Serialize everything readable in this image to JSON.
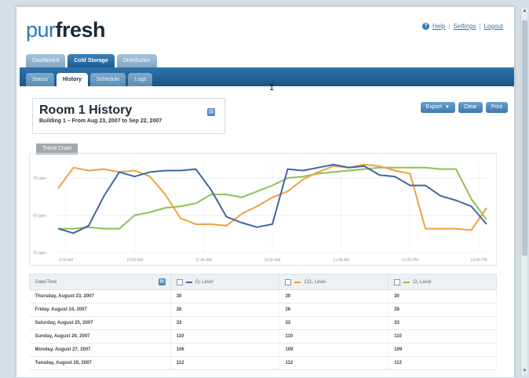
{
  "logo": {
    "light": "pur",
    "bold": "fresh"
  },
  "top_links": {
    "help": "Help",
    "settings": "Settings",
    "logout": "Logout"
  },
  "main_tabs": [
    {
      "label": "Dashboard",
      "active": false
    },
    {
      "label": "Cold Storage",
      "active": true
    },
    {
      "label": "Distribution",
      "active": false
    }
  ],
  "sub_tabs": [
    {
      "label": "Status",
      "active": false
    },
    {
      "label": "History",
      "active": true
    },
    {
      "label": "Schedule",
      "active": false
    },
    {
      "label": "Logs",
      "active": false
    }
  ],
  "header": {
    "title": "Room 1 History",
    "subtitle": "Building 1 – From Aug 23, 2007 to Sep 22, 2007"
  },
  "actions": {
    "export": "Export",
    "clear": "Clear",
    "print": "Print"
  },
  "trend_button": "Trend Chart",
  "colors": {
    "series1": "#3f67a1",
    "series2": "#f0a040",
    "series3": "#8fc04f",
    "accent": "#2d78b7"
  },
  "chart_data": {
    "type": "line",
    "x": [
      "9:00 AM",
      "10:00 AM",
      "11:00 AM",
      "11:00 AM",
      "11:00 AM",
      "12:00 PM",
      "12:00 PM"
    ],
    "yticks": [
      "25 ppm",
      "50 ppm",
      "75 ppm"
    ],
    "ylim": [
      25,
      85
    ],
    "grid": true,
    "series": [
      {
        "color": "#3f67a1",
        "values": [
          41,
          38,
          43,
          63,
          79,
          76,
          79,
          80,
          80,
          81,
          67,
          49,
          45,
          42,
          44,
          81,
          80,
          82,
          84,
          82,
          83,
          77,
          76,
          70,
          70,
          63,
          60,
          56,
          44
        ]
      },
      {
        "color": "#f0a040",
        "values": [
          68,
          82,
          80,
          81,
          79,
          80,
          76,
          64,
          48,
          44,
          44,
          43,
          51,
          56,
          62,
          66,
          74,
          79,
          83,
          82,
          84,
          83,
          80,
          78,
          41,
          41,
          41,
          40,
          55
        ]
      },
      {
        "color": "#8fc04f",
        "values": [
          41,
          41,
          42,
          41,
          41,
          50,
          52,
          55,
          56,
          58,
          64,
          64,
          62,
          66,
          70,
          75,
          76,
          78,
          79,
          80,
          81,
          82,
          82,
          82,
          82,
          81,
          81,
          61,
          47
        ]
      }
    ]
  },
  "table": {
    "headers": [
      "Date/Time",
      "O₂ Level",
      "CO₂ Level",
      "O₃ Level"
    ],
    "rows": [
      [
        "Thursday, August 23, 2007",
        "30",
        "30",
        "30"
      ],
      [
        "Friday, August 24, 2007",
        "28",
        "26",
        "28"
      ],
      [
        "Saturday, August 25, 2007",
        "33",
        "33",
        "33"
      ],
      [
        "Sunday, August 26, 2007",
        "110",
        "110",
        "110"
      ],
      [
        "Monday, August 27, 2007",
        "106",
        "109",
        "109"
      ],
      [
        "Tuesday, August 28, 2007",
        "112",
        "112",
        "112"
      ]
    ]
  }
}
